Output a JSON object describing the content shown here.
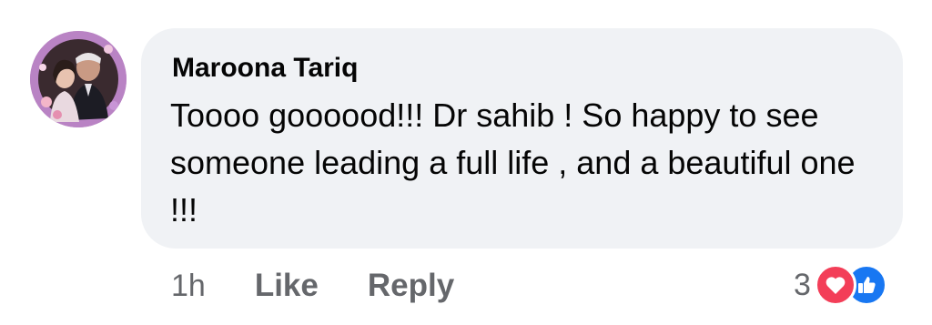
{
  "comment": {
    "author": "Maroona Tariq",
    "text": "Toooo goooood!!! Dr sahib ! So happy to see someone leading a full life , and a beautiful one !!!",
    "timestamp": "1h",
    "like_label": "Like",
    "reply_label": "Reply"
  },
  "reactions": {
    "count": "3",
    "types": [
      "love-icon",
      "like-icon"
    ]
  },
  "colors": {
    "bubble_bg": "#f0f2f5",
    "meta_text": "#65676b",
    "love": "#f33e58",
    "like": "#1877f2"
  }
}
